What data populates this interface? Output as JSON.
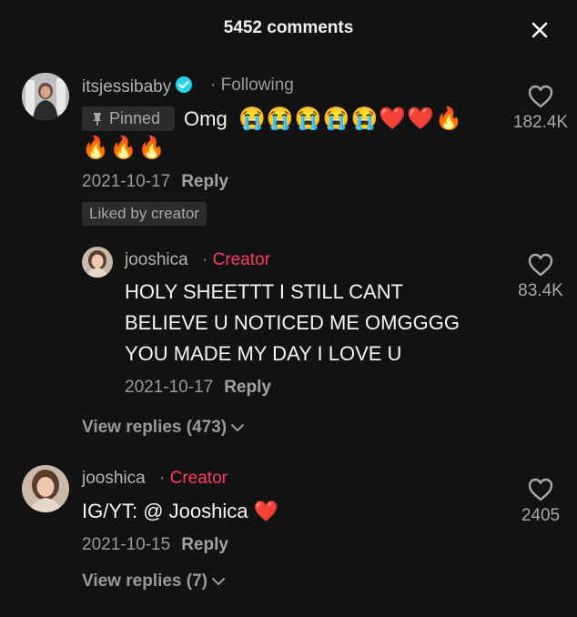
{
  "header": {
    "title": "5452 comments",
    "close_icon": "close-icon"
  },
  "comments": [
    {
      "username": "itsjessibaby",
      "verified": true,
      "separator": "·",
      "relation": "Following",
      "pinned_label": "Pinned",
      "text": "Omg",
      "emoji_line1": "😭😭😭😭😭❤️❤️🔥",
      "emoji_line2": "🔥🔥🔥",
      "date": "2021-10-17",
      "reply_label": "Reply",
      "liked_by_creator": "Liked by creator",
      "likes": "182.4K",
      "reply": {
        "username": "jooshica",
        "separator": "·",
        "badge": "Creator",
        "text_lines": [
          "HOLY SHEETTT I STILL CANT",
          "BELIEVE U NOTICED ME OMGGGG",
          "YOU MADE MY DAY I LOVE U"
        ],
        "date": "2021-10-17",
        "reply_label": "Reply",
        "likes": "83.4K"
      },
      "view_replies": "View replies (473)"
    },
    {
      "username": "jooshica",
      "separator": "·",
      "badge": "Creator",
      "text": "IG/YT: @ Jooshica",
      "emoji": "❤️",
      "date": "2021-10-15",
      "reply_label": "Reply",
      "likes": "2405",
      "view_replies": "View replies (7)"
    }
  ],
  "colors": {
    "background": "#121212",
    "creator_badge": "#ff3b5c",
    "verified": "#20d5ec",
    "muted_text": "#9a9a9a"
  }
}
